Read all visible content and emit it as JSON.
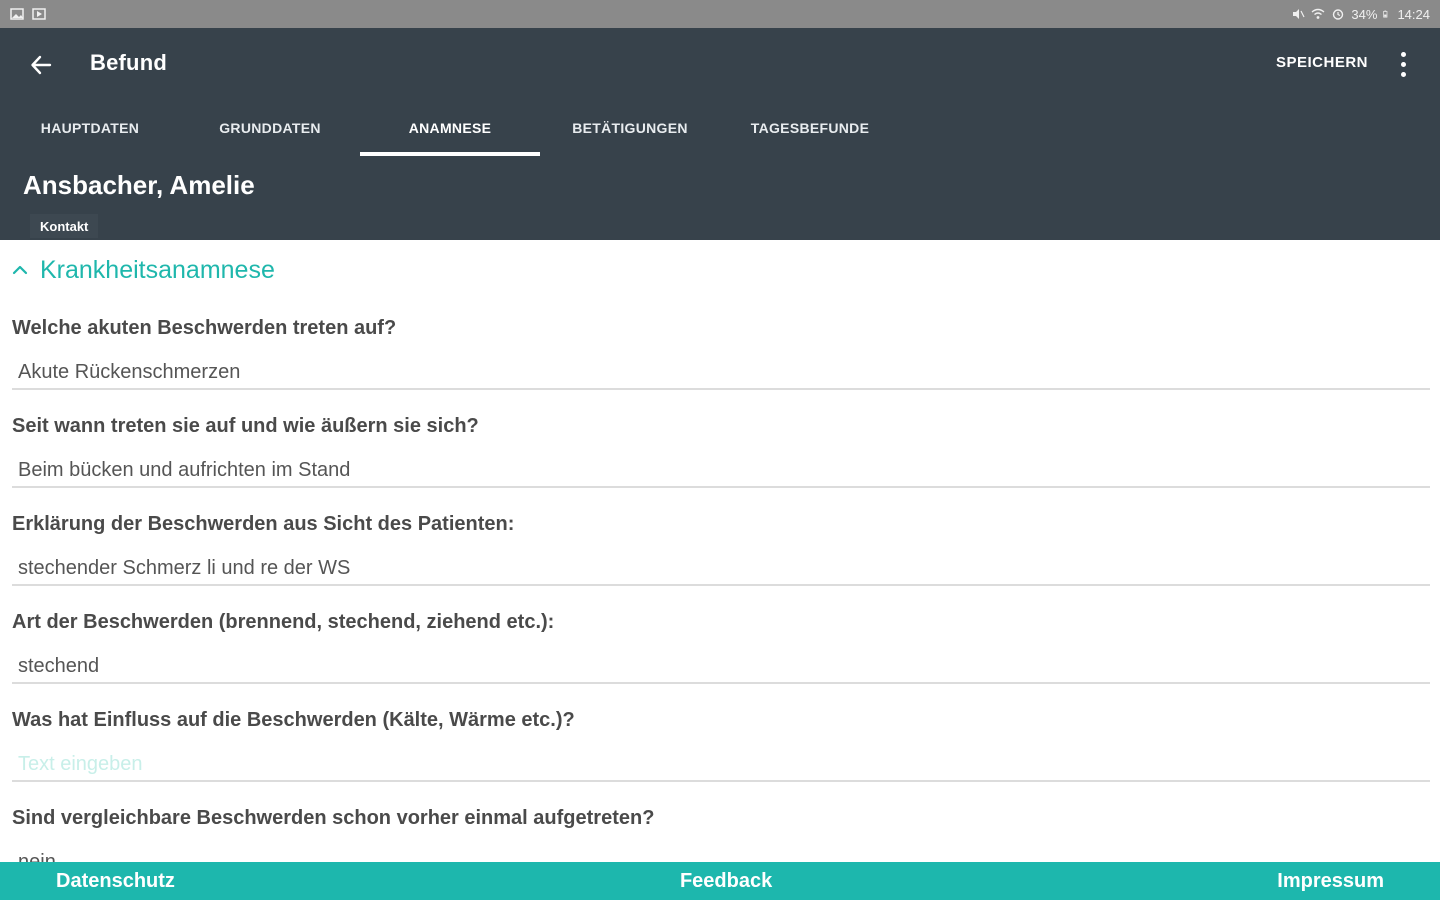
{
  "status_bar": {
    "battery": "34%",
    "time": "14:24"
  },
  "toolbar": {
    "title": "Befund",
    "save_label": "SPEICHERN"
  },
  "tabs": [
    {
      "label": "HAUPTDATEN",
      "active": false
    },
    {
      "label": "GRUNDDATEN",
      "active": false
    },
    {
      "label": "ANAMNESE",
      "active": true
    },
    {
      "label": "BETÄTIGUNGEN",
      "active": false
    },
    {
      "label": "TAGESBEFUNDE",
      "active": false
    }
  ],
  "patient": {
    "name": "Ansbacher, Amelie",
    "contact_label": "Kontakt"
  },
  "section": {
    "title": "Krankheitsanamnese",
    "expanded": true
  },
  "questions": [
    {
      "label": "Welche akuten Beschwerden treten auf?",
      "value": "Akute Rückenschmerzen",
      "placeholder": ""
    },
    {
      "label": "Seit wann treten sie auf und wie äußern sie sich?",
      "value": "Beim bücken und aufrichten im Stand",
      "placeholder": ""
    },
    {
      "label": "Erklärung der Beschwerden aus Sicht des Patienten:",
      "value": "stechender Schmerz li und re der WS",
      "placeholder": ""
    },
    {
      "label": "Art der Beschwerden (brennend, stechend, ziehend etc.):",
      "value": "stechend",
      "placeholder": ""
    },
    {
      "label": "Was hat Einfluss auf die Beschwerden (Kälte, Wärme etc.)?",
      "value": "",
      "placeholder": "Text eingeben"
    },
    {
      "label": "Sind vergleichbare Beschwerden schon vorher einmal aufgetreten?",
      "value": "nein",
      "placeholder": ""
    }
  ],
  "footer": {
    "privacy": "Datenschutz",
    "feedback": "Feedback",
    "imprint": "Impressum"
  },
  "colors": {
    "header_bg": "#37424b",
    "accent": "#1db7ad",
    "status_bar_bg": "#8a8a8a"
  }
}
